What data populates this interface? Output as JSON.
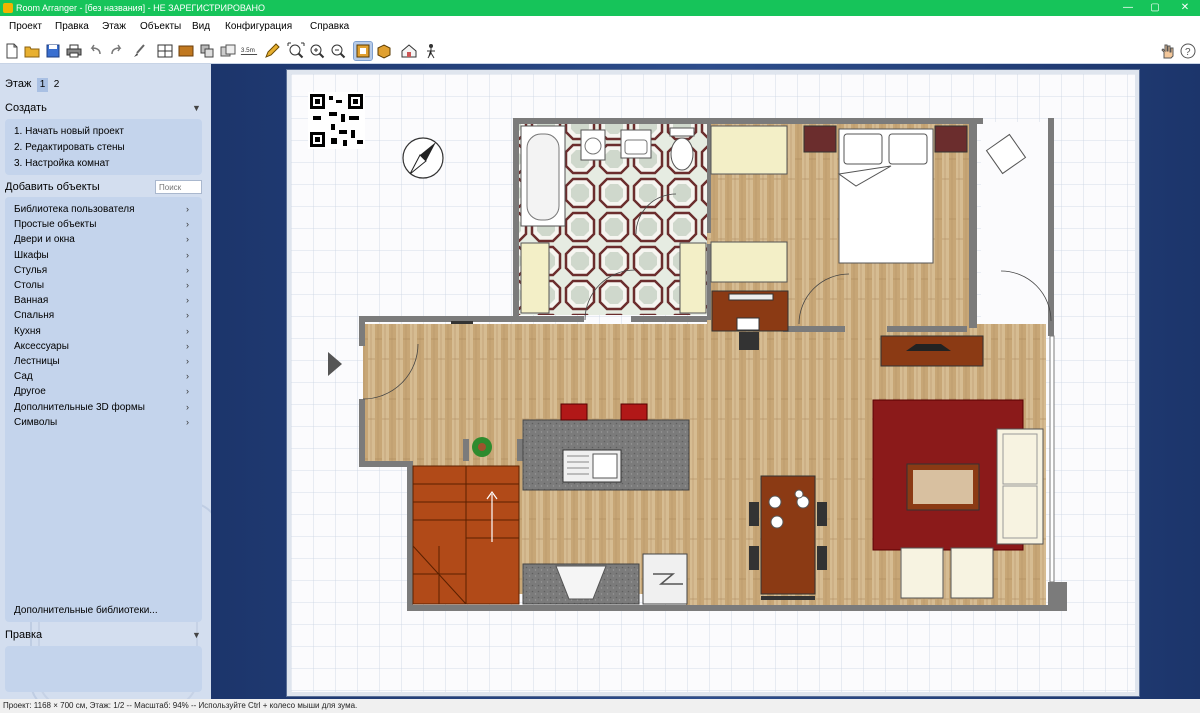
{
  "window": {
    "title": "Room Arranger - [без названия] - НЕ ЗАРЕГИСТРИРОВАНО",
    "controls": {
      "minimize": "—",
      "maximize": "▢",
      "close": "✕"
    }
  },
  "menu": {
    "items": [
      "Проект",
      "Правка",
      "Этаж",
      "Объекты",
      "Вид",
      "Конфигурация",
      "Справка"
    ]
  },
  "toolbar": {
    "tools": [
      "new-icon",
      "open-icon",
      "save-icon",
      "print-icon",
      "undo-icon",
      "redo-icon",
      "brush-icon",
      "wall-icon",
      "floor-icon",
      "group-icon",
      "copy-icon",
      "measure-icon",
      "pencil-icon",
      "zoom-fit-icon",
      "zoom-in-icon",
      "zoom-out-icon",
      "view-2d-icon",
      "view-3d-box-icon",
      "3d-house-icon",
      "3d-walk-icon",
      "hand-icon",
      "help-icon"
    ],
    "measure_label": "3.5m"
  },
  "sidebar": {
    "floor_label": "Этаж",
    "floors": [
      "1",
      "2"
    ],
    "create": {
      "title": "Создать",
      "steps": [
        "1. Начать новый проект",
        "2. Редактировать стены",
        "3. Настройка комнат"
      ]
    },
    "add_objects": {
      "title": "Добавить объекты",
      "search_placeholder": "Поиск",
      "categories": [
        "Библиотека пользователя",
        "Простые объекты",
        "Двери и окна",
        "Шкафы",
        "Стулья",
        "Столы",
        "Ванная",
        "Спальня",
        "Кухня",
        "Аксессуары",
        "Лестницы",
        "Сад",
        "Другое",
        "Дополнительные 3D формы",
        "Символы"
      ],
      "more_libraries": "Дополнительные библиотеки..."
    },
    "edit": {
      "title": "Правка"
    }
  },
  "plan": {
    "colors": {
      "wall": "#7b7b7b",
      "wood_floor": "#d2b48c",
      "tile_floor": "#dfe7dc",
      "rug": "#8b1a1a",
      "stairs": "#b14a18",
      "counter": "#7f7f7f"
    }
  },
  "status": {
    "text": "Проект: 1168 × 700 см, Этаж: 1/2 -- Масштаб: 94% -- Используйте Ctrl + колесо мыши для зума."
  }
}
